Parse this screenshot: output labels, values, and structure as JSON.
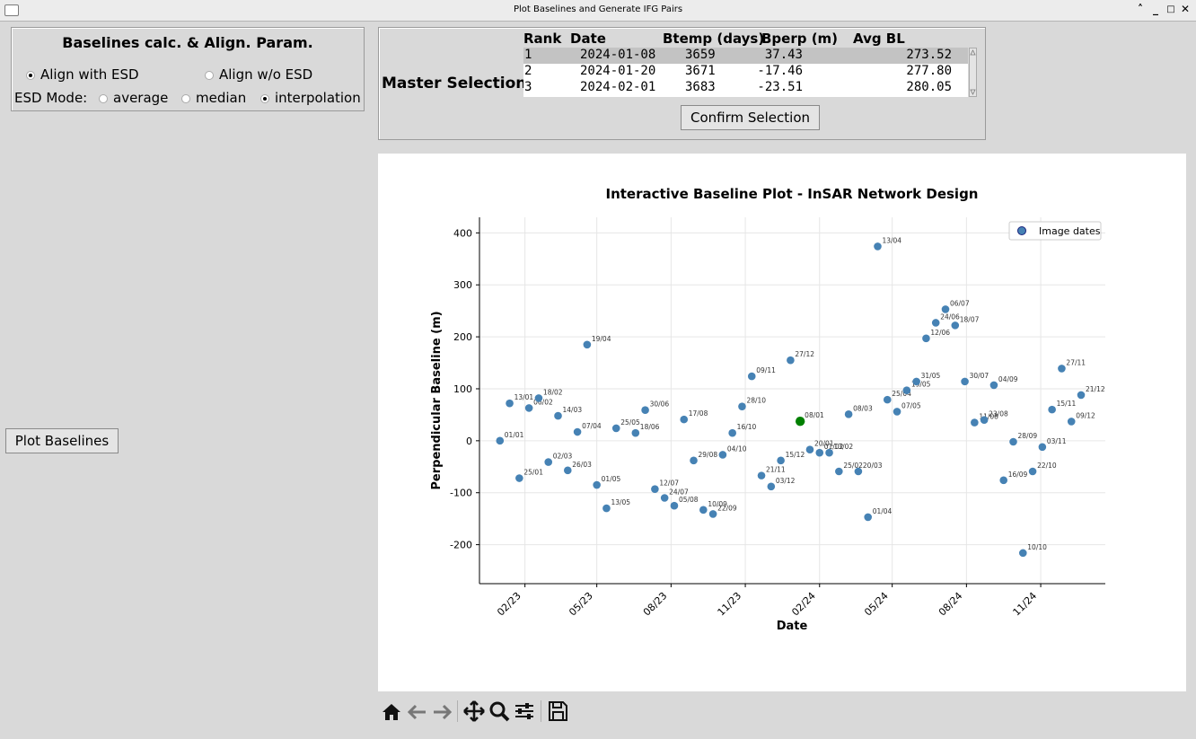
{
  "window": {
    "title": "Plot Baselines and Generate IFG Pairs"
  },
  "baselines_panel": {
    "title": "Baselines calc. & Align. Param.",
    "align_with_esd": "Align with ESD",
    "align_without_esd": "Align w/o ESD",
    "esd_mode_label": "ESD Mode:",
    "mode_average": "average",
    "mode_median": "median",
    "mode_interpolation": "interpolation",
    "selected_align": "with_esd",
    "selected_mode": "interpolation"
  },
  "master_selection": {
    "label": "Master Selection",
    "columns": [
      "Rank",
      "Date",
      "Btemp (days)",
      "Bperp (m)",
      "Avg BL"
    ],
    "rows": [
      [
        "1",
        "2024-01-08",
        "3659",
        "37.43",
        "273.52"
      ],
      [
        "2",
        "2024-01-20",
        "3671",
        "-17.46",
        "277.80"
      ],
      [
        "3",
        "2024-02-01",
        "3683",
        "-23.51",
        "280.05"
      ]
    ],
    "confirm_label": "Confirm Selection"
  },
  "plot_button_label": "Plot Baselines",
  "toolbar": [
    "home-icon",
    "back-icon",
    "forward-icon",
    "pan-icon",
    "zoom-icon",
    "configure-icon",
    "save-icon"
  ],
  "colors": {
    "point": "#4682b4",
    "master": "#008000"
  },
  "chart_data": {
    "type": "scatter",
    "title": "Interactive Baseline Plot - InSAR Network Design",
    "xlabel": "Date",
    "ylabel": "Perpendicular Baseline (m)",
    "legend": "Image dates",
    "legend_position": "top-right",
    "ylim": [
      -275,
      430
    ],
    "yticks": [
      -200,
      -100,
      0,
      100,
      200,
      300,
      400
    ],
    "xlim": [
      "2022-12-20",
      "2024-12-31"
    ],
    "xticks": [
      "2023-02-01",
      "2023-05-01",
      "2023-08-01",
      "2023-11-01",
      "2024-02-01",
      "2024-05-01",
      "2024-08-01",
      "2024-11-01"
    ],
    "xtick_labels": [
      "02/23",
      "05/23",
      "08/23",
      "11/23",
      "02/24",
      "05/24",
      "08/24",
      "11/24"
    ],
    "grid": true,
    "master": {
      "date": "2024-01-08",
      "label": "08/01",
      "bperp": 37.43
    },
    "points": [
      {
        "date": "2023-01-01",
        "label": "01/01",
        "bperp": 0
      },
      {
        "date": "2023-01-13",
        "label": "13/01",
        "bperp": 72
      },
      {
        "date": "2023-01-25",
        "label": "25/01",
        "bperp": -72
      },
      {
        "date": "2023-02-06",
        "label": "06/02",
        "bperp": 63
      },
      {
        "date": "2023-02-18",
        "label": "18/02",
        "bperp": 82
      },
      {
        "date": "2023-03-02",
        "label": "02/03",
        "bperp": -41
      },
      {
        "date": "2023-03-14",
        "label": "14/03",
        "bperp": 48
      },
      {
        "date": "2023-03-26",
        "label": "26/03",
        "bperp": -57
      },
      {
        "date": "2023-04-07",
        "label": "07/04",
        "bperp": 17
      },
      {
        "date": "2023-04-19",
        "label": "19/04",
        "bperp": 185
      },
      {
        "date": "2023-05-01",
        "label": "01/05",
        "bperp": -85
      },
      {
        "date": "2023-05-13",
        "label": "13/05",
        "bperp": -130
      },
      {
        "date": "2023-05-25",
        "label": "25/05",
        "bperp": 24
      },
      {
        "date": "2023-06-18",
        "label": "18/06",
        "bperp": 15
      },
      {
        "date": "2023-06-30",
        "label": "30/06",
        "bperp": 59
      },
      {
        "date": "2023-07-12",
        "label": "12/07",
        "bperp": -93
      },
      {
        "date": "2023-07-24",
        "label": "24/07",
        "bperp": -110
      },
      {
        "date": "2023-08-05",
        "label": "05/08",
        "bperp": -125
      },
      {
        "date": "2023-08-17",
        "label": "17/08",
        "bperp": 41
      },
      {
        "date": "2023-08-29",
        "label": "29/08",
        "bperp": -38
      },
      {
        "date": "2023-09-10",
        "label": "10/09",
        "bperp": -133
      },
      {
        "date": "2023-09-22",
        "label": "22/09",
        "bperp": -141
      },
      {
        "date": "2023-10-04",
        "label": "04/10",
        "bperp": -27
      },
      {
        "date": "2023-10-16",
        "label": "16/10",
        "bperp": 15
      },
      {
        "date": "2023-10-28",
        "label": "28/10",
        "bperp": 66
      },
      {
        "date": "2023-11-09",
        "label": "09/11",
        "bperp": 124
      },
      {
        "date": "2023-11-21",
        "label": "21/11",
        "bperp": -67
      },
      {
        "date": "2023-12-03",
        "label": "03/12",
        "bperp": -88
      },
      {
        "date": "2023-12-15",
        "label": "15/12",
        "bperp": -38
      },
      {
        "date": "2023-12-27",
        "label": "27/12",
        "bperp": 155
      },
      {
        "date": "2024-01-20",
        "label": "20/01",
        "bperp": -17
      },
      {
        "date": "2024-02-01",
        "label": "01/02",
        "bperp": -23
      },
      {
        "date": "2024-02-13",
        "label": "13/02",
        "bperp": -23
      },
      {
        "date": "2024-02-25",
        "label": "25/02",
        "bperp": -59
      },
      {
        "date": "2024-03-08",
        "label": "08/03",
        "bperp": 51
      },
      {
        "date": "2024-03-20",
        "label": "20/03",
        "bperp": -59
      },
      {
        "date": "2024-04-01",
        "label": "01/04",
        "bperp": -147
      },
      {
        "date": "2024-04-13",
        "label": "13/04",
        "bperp": 374
      },
      {
        "date": "2024-04-25",
        "label": "25/04",
        "bperp": 79
      },
      {
        "date": "2024-05-07",
        "label": "07/05",
        "bperp": 56
      },
      {
        "date": "2024-05-19",
        "label": "19/05",
        "bperp": 97
      },
      {
        "date": "2024-05-31",
        "label": "31/05",
        "bperp": 114
      },
      {
        "date": "2024-06-12",
        "label": "12/06",
        "bperp": 197
      },
      {
        "date": "2024-06-24",
        "label": "24/06",
        "bperp": 227
      },
      {
        "date": "2024-07-06",
        "label": "06/07",
        "bperp": 253
      },
      {
        "date": "2024-07-18",
        "label": "18/07",
        "bperp": 222
      },
      {
        "date": "2024-07-30",
        "label": "30/07",
        "bperp": 114
      },
      {
        "date": "2024-08-11",
        "label": "11/08",
        "bperp": 35
      },
      {
        "date": "2024-08-23",
        "label": "23/08",
        "bperp": 40
      },
      {
        "date": "2024-09-04",
        "label": "04/09",
        "bperp": 107
      },
      {
        "date": "2024-09-16",
        "label": "16/09",
        "bperp": -76
      },
      {
        "date": "2024-09-28",
        "label": "28/09",
        "bperp": -2
      },
      {
        "date": "2024-10-10",
        "label": "10/10",
        "bperp": -216
      },
      {
        "date": "2024-10-22",
        "label": "22/10",
        "bperp": -59
      },
      {
        "date": "2024-11-03",
        "label": "03/11",
        "bperp": -12
      },
      {
        "date": "2024-11-15",
        "label": "15/11",
        "bperp": 60
      },
      {
        "date": "2024-11-27",
        "label": "27/11",
        "bperp": 139
      },
      {
        "date": "2024-12-09",
        "label": "09/12",
        "bperp": 37
      },
      {
        "date": "2024-12-21",
        "label": "21/12",
        "bperp": 88
      }
    ]
  }
}
